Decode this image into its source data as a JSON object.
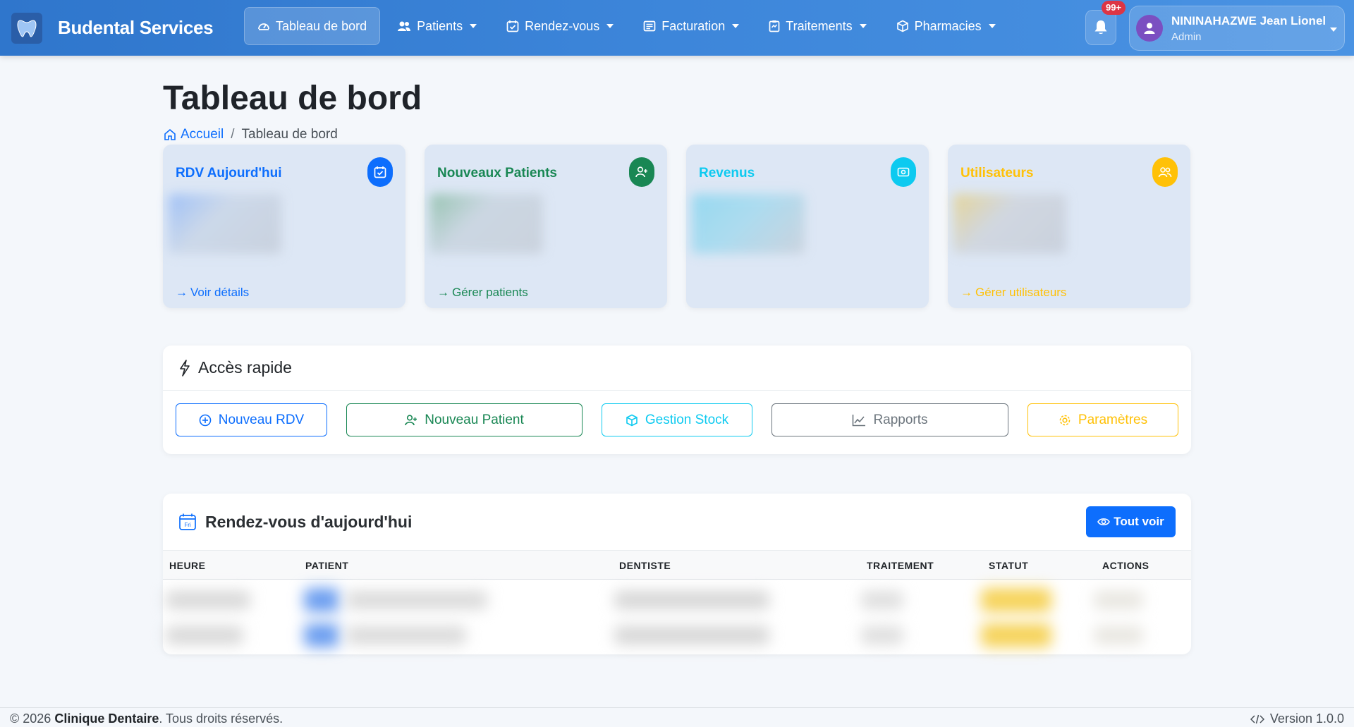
{
  "brand": {
    "name": "Budental Services"
  },
  "nav": {
    "items": [
      {
        "label": "Tableau de bord",
        "icon": "dashboard-icon",
        "active": true
      },
      {
        "label": "Patients",
        "icon": "users-icon"
      },
      {
        "label": "Rendez-vous",
        "icon": "calendar-check-icon"
      },
      {
        "label": "Facturation",
        "icon": "receipt-icon"
      },
      {
        "label": "Traitements",
        "icon": "clipboard-icon"
      },
      {
        "label": "Pharmacies",
        "icon": "box-icon"
      }
    ],
    "notifications_badge": "99+",
    "user": {
      "name": "NININAHAZWE Jean Lionel",
      "role": "Admin"
    }
  },
  "page": {
    "title": "Tableau de bord",
    "breadcrumb": {
      "home": "Accueil",
      "current": "Tableau de bord"
    }
  },
  "cards": [
    {
      "title": "RDV Aujourd'hui",
      "link": "Voir détails",
      "color": "#0d6efd",
      "icon": "calendar-check-icon"
    },
    {
      "title": "Nouveaux Patients",
      "link": "Gérer patients",
      "color": "#198754",
      "icon": "person-add-icon"
    },
    {
      "title": "Revenus",
      "link": "",
      "color": "#0dcaf0",
      "icon": "cash-icon"
    },
    {
      "title": "Utilisateurs",
      "link": "Gérer utilisateurs",
      "color": "#ffc107",
      "icon": "people-icon"
    }
  ],
  "quick_access": {
    "title": "Accès rapide",
    "buttons": [
      {
        "label": "Nouveau RDV",
        "color": "#0d6efd"
      },
      {
        "label": "Nouveau Patient",
        "color": "#198754"
      },
      {
        "label": "Gestion Stock",
        "color": "#0dcaf0"
      },
      {
        "label": "Rapports",
        "color": "#6c757d"
      },
      {
        "label": "Paramètres",
        "color": "#ffc107"
      }
    ]
  },
  "appointments": {
    "title": "Rendez-vous d'aujourd'hui",
    "view_all": "Tout voir",
    "calendar_day": "Fri",
    "columns": [
      "HEURE",
      "PATIENT",
      "DENTISTE",
      "TRAITEMENT",
      "STATUT",
      "ACTIONS"
    ]
  },
  "footer": {
    "copyright_prefix": "© 2026",
    "clinic": "Clinique Dentaire",
    "rights": ". Tous droits réservés.",
    "version": "Version 1.0.0"
  }
}
